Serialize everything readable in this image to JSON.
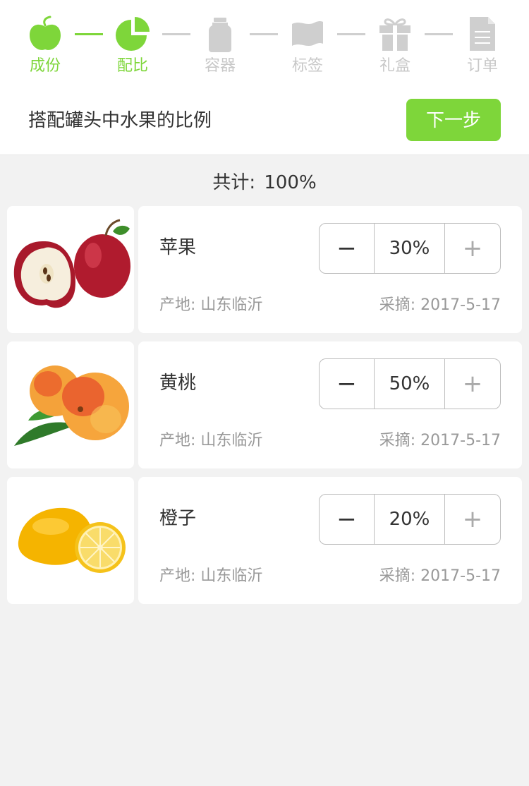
{
  "steps": [
    {
      "label": "成份",
      "icon": "apple-icon",
      "active": true
    },
    {
      "label": "配比",
      "icon": "pie-chart-icon",
      "active": true
    },
    {
      "label": "容器",
      "icon": "jar-icon",
      "active": false
    },
    {
      "label": "标签",
      "icon": "flag-icon",
      "active": false
    },
    {
      "label": "礼盒",
      "icon": "gift-icon",
      "active": false
    },
    {
      "label": "订单",
      "icon": "document-icon",
      "active": false
    }
  ],
  "instruction": "搭配罐头中水果的比例",
  "next_button": "下一步",
  "total": {
    "label": "共计:",
    "value": "100%"
  },
  "fruits": [
    {
      "name": "苹果",
      "minus": "−",
      "value": "30%",
      "plus": "+",
      "origin": "产地: 山东临沂",
      "picked": "采摘: 2017-5-17",
      "image": "apple-image"
    },
    {
      "name": "黄桃",
      "minus": "−",
      "value": "50%",
      "plus": "+",
      "origin": "产地: 山东临沂",
      "picked": "采摘: 2017-5-17",
      "image": "peach-image"
    },
    {
      "name": "橙子",
      "minus": "−",
      "value": "20%",
      "plus": "+",
      "origin": "产地: 山东临沂",
      "picked": "采摘: 2017-5-17",
      "image": "lemon-image"
    }
  ],
  "colors": {
    "accent": "#7ed63a",
    "inactive": "#c8c8c8",
    "background": "#f2f2f2"
  }
}
